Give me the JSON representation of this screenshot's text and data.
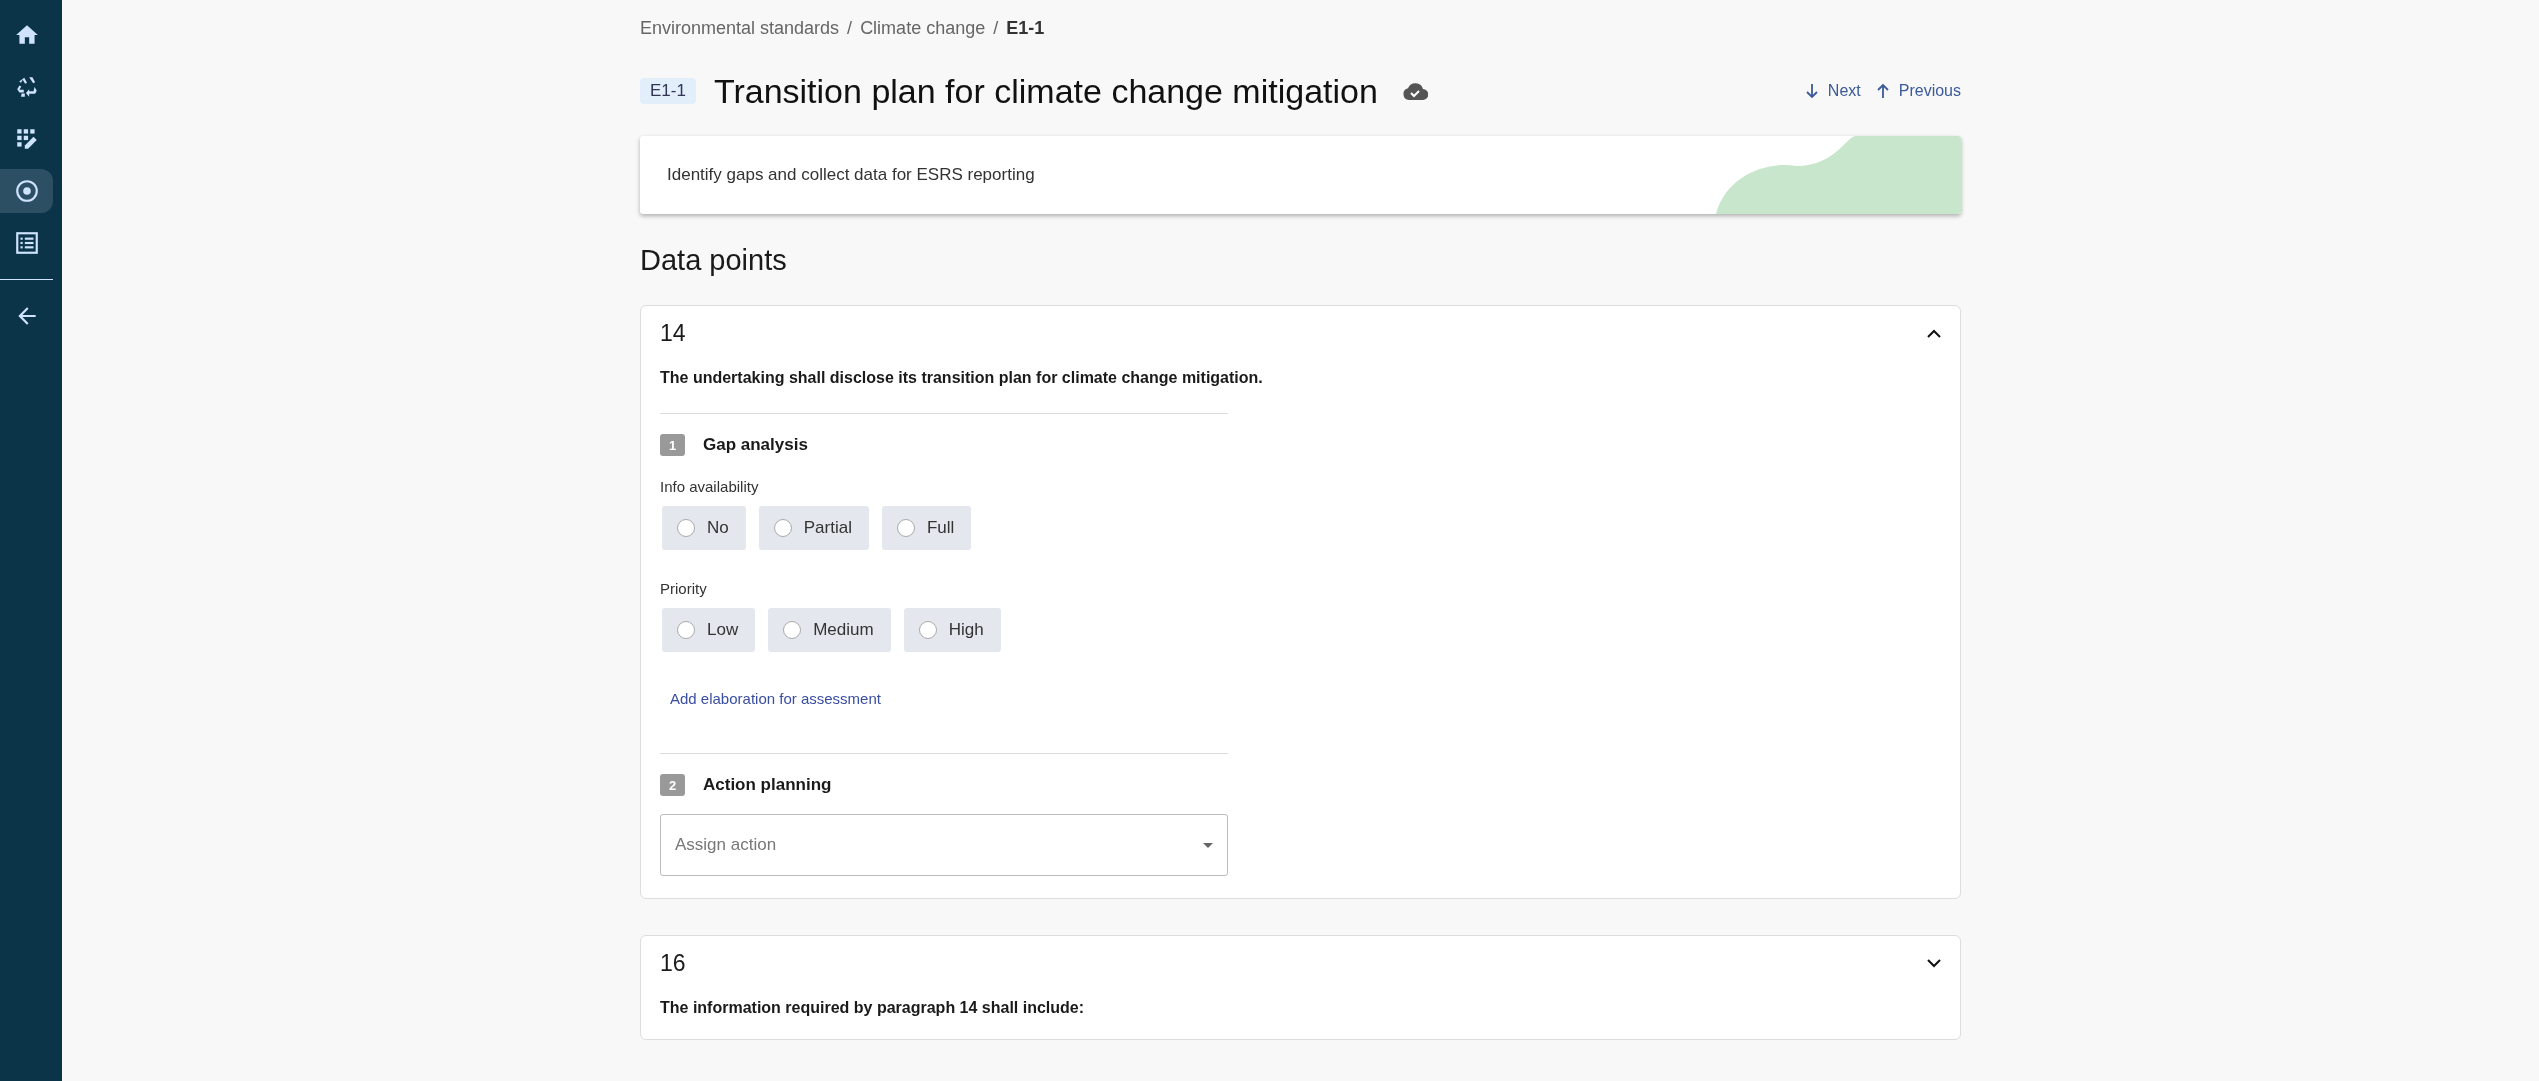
{
  "sidebar": {
    "items": [
      {
        "selected": false
      },
      {
        "selected": false
      },
      {
        "selected": false
      },
      {
        "selected": true
      },
      {
        "selected": false
      }
    ]
  },
  "breadcrumb": [
    {
      "label": "Environmental standards",
      "current": false
    },
    {
      "separator": "/"
    },
    {
      "label": "Climate change",
      "current": false
    },
    {
      "separator": "/"
    },
    {
      "label": "E1-1",
      "current": true
    }
  ],
  "header": {
    "code": "E1-1",
    "title": "Transition plan for climate change mitigation",
    "next": "Next",
    "previous": "Previous"
  },
  "banner": {
    "text": "Identify gaps and collect data for ESRS reporting"
  },
  "section_title": "Data points",
  "cards": [
    {
      "number": "14",
      "expanded": true,
      "statement": "The undertaking shall disclose its transition plan for climate change mitigation.",
      "steps": [
        {
          "kind": "gap",
          "index": "1",
          "title": "Gap analysis",
          "groups": [
            {
              "label": "Info availability",
              "options": [
                {
                  "label": "No",
                  "selected": false
                },
                {
                  "label": "Partial",
                  "selected": false
                },
                {
                  "label": "Full",
                  "selected": false
                }
              ]
            },
            {
              "label": "Priority",
              "options": [
                {
                  "label": "Low",
                  "selected": false
                },
                {
                  "label": "Medium",
                  "selected": false
                },
                {
                  "label": "High",
                  "selected": false
                }
              ]
            }
          ],
          "link": "Add elaboration for assessment"
        },
        {
          "kind": "action",
          "index": "2",
          "title": "Action planning",
          "select": {
            "placeholder": "Assign action"
          }
        }
      ]
    },
    {
      "number": "16",
      "expanded": false,
      "statement": "The information required by paragraph 14 shall include:"
    }
  ]
}
